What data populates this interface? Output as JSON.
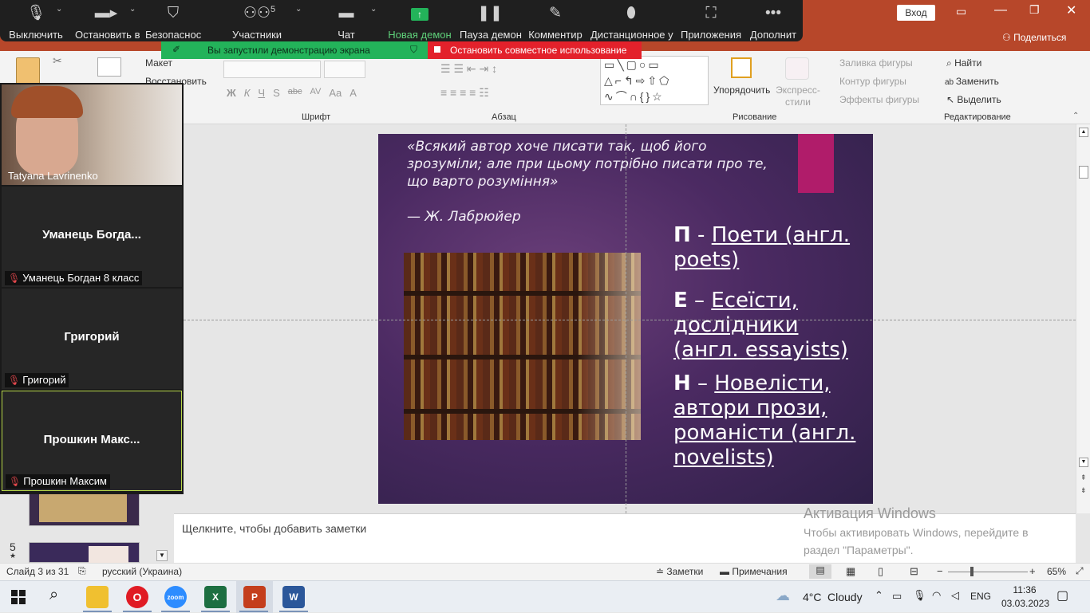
{
  "app": {
    "title_bar": {
      "signin": "Вход",
      "share": "Поделиться"
    },
    "ribbon": {
      "clipboard": {
        "layout": "Макет",
        "reset": "Восстановить"
      },
      "font_group": "Шрифт",
      "paragraph_group": "Абзац",
      "drawing_group": "Рисование",
      "editing_group": "Редактирование",
      "arrange": "Упорядочить",
      "quick_styles": "Экспресс-стили",
      "shape_fill": "Заливка фигуры",
      "shape_outline": "Контур фигуры",
      "shape_effects": "Эффекты фигуры",
      "find": "Найти",
      "replace": "Заменить",
      "select": "Выделить",
      "font_buttons": [
        "Ж",
        "К",
        "Ч",
        "S",
        "abc",
        "AV",
        "Aa",
        "A"
      ]
    },
    "slide": {
      "quote": "«Всякий автор хоче писати так, щоб його зрозуміли; але при цьому потрібно писати про те, що варто розуміння»",
      "author": "— Ж. Лабрюйер",
      "acrostic": [
        {
          "letter": "П",
          "sep": " - ",
          "text": "Поети (англ. poets)"
        },
        {
          "letter": "Е",
          "sep": " – ",
          "text": "Есеїсти, дослідники (англ. essayists)"
        },
        {
          "letter": "Н",
          "sep": " – ",
          "text": "Новелісти, автори прози, романісти (англ. novelists)"
        }
      ]
    },
    "thumbnails": {
      "slide5_number": "5"
    },
    "notes_placeholder": "Щелкните, чтобы добавить заметки",
    "activation": {
      "title": "Активация Windows",
      "subtitle": "Чтобы активировать Windows, перейдите в раздел \"Параметры\"."
    },
    "status": {
      "slide_counter": "Слайд 3 из 31",
      "language": "русский (Украина)",
      "notes_btn": "Заметки",
      "comments_btn": "Примечания",
      "zoom": "65%"
    }
  },
  "zoom": {
    "toolbar": [
      {
        "label": "Выключить",
        "icon": "mic-icon"
      },
      {
        "label": "Остановить в",
        "icon": "video-icon"
      },
      {
        "label": "Безопаснос",
        "icon": "shield-icon"
      },
      {
        "label": "Участники",
        "icon": "participants-icon",
        "count": "5"
      },
      {
        "label": "Чат",
        "icon": "chat-icon"
      },
      {
        "label": "Новая демон",
        "icon": "share-screen-icon"
      },
      {
        "label": "Пауза демон",
        "icon": "pause-icon"
      },
      {
        "label": "Комментир",
        "icon": "annotate-icon"
      },
      {
        "label": "Дистанционное у",
        "icon": "remote-control-icon"
      },
      {
        "label": "Приложения",
        "icon": "apps-icon"
      },
      {
        "label": "Дополнит",
        "icon": "more-icon"
      }
    ],
    "share_status": "Вы запустили демонстрацию экрана",
    "stop_share": "Остановить совместное использование",
    "participants": [
      {
        "name": "Tatyana Lavrinenko"
      },
      {
        "display": "Уманець  Богда...",
        "label": "Уманець Богдан 8 класс"
      },
      {
        "display": "Григорий",
        "label": "Григорий"
      },
      {
        "display": "Прошкин  Макс...",
        "label": "Прошкин Максим"
      }
    ]
  },
  "taskbar": {
    "weather_temp": "4°C",
    "weather_desc": "Cloudy",
    "lang": "ENG",
    "time": "11:36",
    "date": "03.03.2023"
  },
  "colors": {
    "ppt_brand": "#b7472a",
    "zoom_green": "#23b35a",
    "zoom_red": "#e3212b",
    "slide_accent": "#b01c6a"
  }
}
